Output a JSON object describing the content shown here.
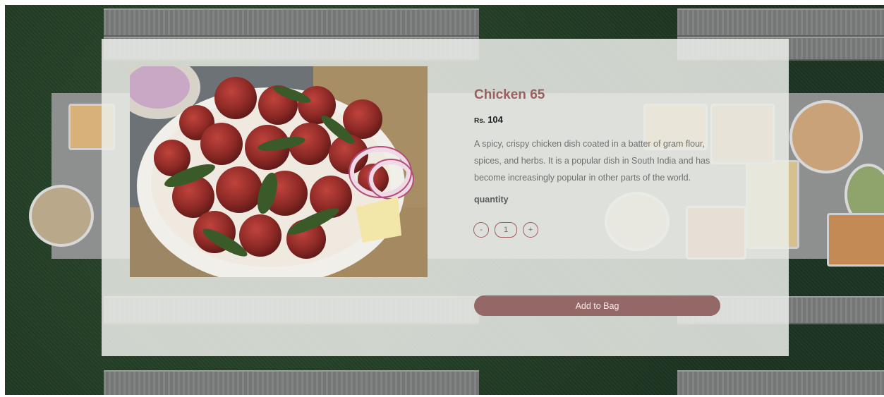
{
  "product": {
    "name": "Chicken 65",
    "currency": "Rs.",
    "price": "104",
    "description": "A spicy, crispy chicken dish coated in a batter of gram flour, spices, and herbs. It is a popular dish in South India and has become increasingly popular in other parts of the world.",
    "quantity_label": "quantity",
    "quantity_value": "1",
    "decrement_symbol": "-",
    "increment_symbol": "+",
    "add_to_bag_label": "Add to Bag"
  },
  "theme": {
    "accent": "#946866",
    "title_color": "#9a6060",
    "panel_bg": "rgba(235,237,233,0.86)",
    "grass_bg": "#1f3a22"
  }
}
